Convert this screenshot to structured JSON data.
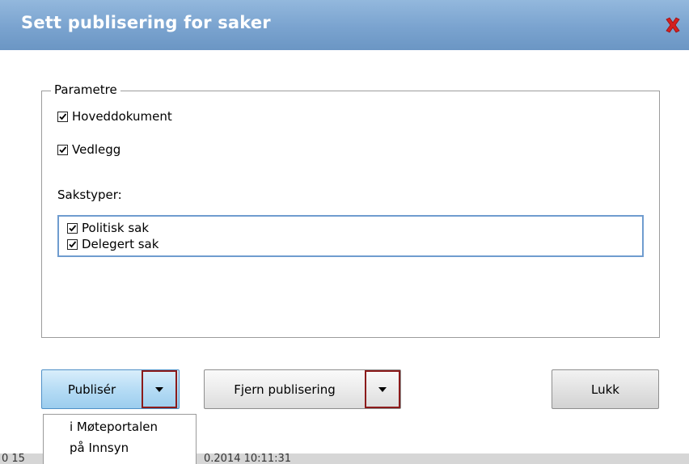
{
  "dialog": {
    "title": "Sett publisering for saker"
  },
  "parameters": {
    "legend": "Parametre",
    "hoveddokument": {
      "label": "Hoveddokument",
      "checked": true
    },
    "vedlegg": {
      "label": "Vedlegg",
      "checked": true
    },
    "sakstyper_label": "Sakstyper:",
    "sakstyper": [
      {
        "label": "Politisk sak",
        "checked": true
      },
      {
        "label": "Delegert sak",
        "checked": true
      }
    ]
  },
  "buttons": {
    "publiser": "Publisér",
    "fjern": "Fjern publisering",
    "lukk": "Lukk"
  },
  "publish_menu": {
    "items": [
      "i Møteportalen",
      "på Innsyn"
    ]
  },
  "statusbar": {
    "left_fragment": "0 15",
    "right_fragment": "0.2014 10:11:31"
  },
  "colors": {
    "title_bg": "#7aa3cf",
    "close_icon": "#d42020",
    "split_border": "#8b1a1a",
    "listbox_border": "#6f9ccf"
  }
}
